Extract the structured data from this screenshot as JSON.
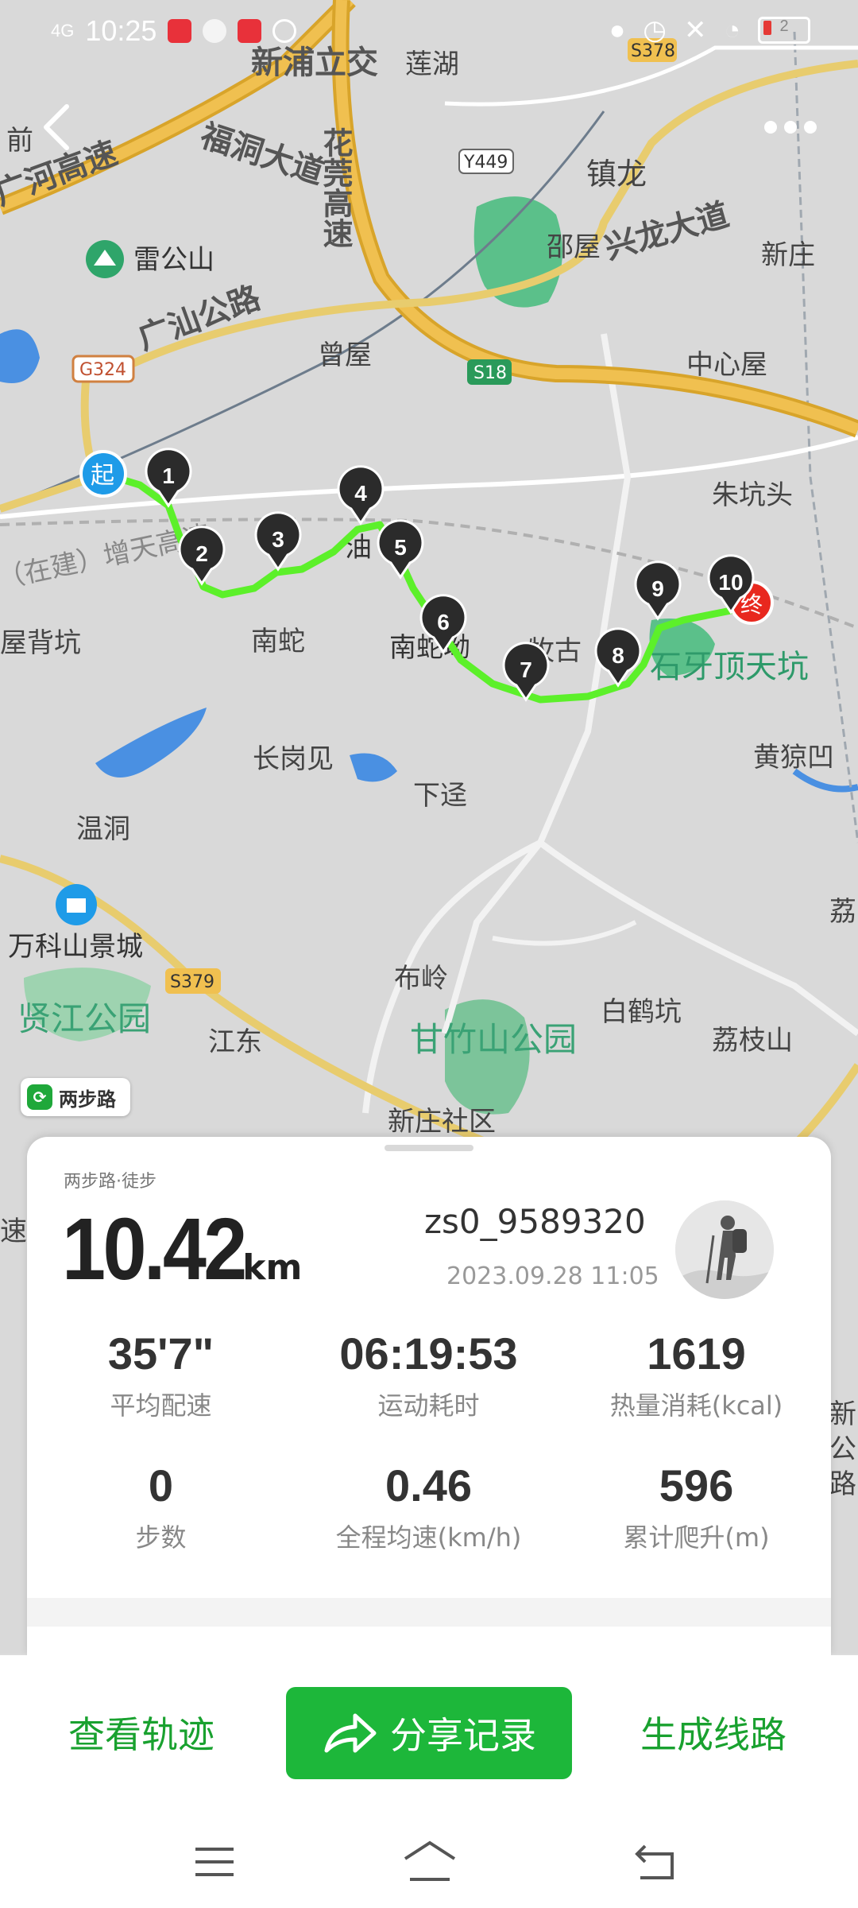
{
  "status_bar": {
    "network": "4G",
    "time": "10:25",
    "battery": "2"
  },
  "map": {
    "roads": {
      "guanghe": "广河高速",
      "fudong": "福洞大道",
      "huaguan": "花莞高速",
      "guangshan": "广汕公路",
      "xinglong": "兴龙大道",
      "xinpu": "新浦立交"
    },
    "road_badges": {
      "g324": "G324",
      "s18": "S18",
      "y449": "Y449",
      "s378": "S378",
      "s379": "S379"
    },
    "places": {
      "qian": "前",
      "lianhu": "莲湖",
      "zhenlong": "镇龙",
      "shaowu": "邵屋",
      "xinzhuang": "新庄",
      "leigongshan": "雷公山",
      "zengwu": "曾屋",
      "zhongxinwu": "中心屋",
      "zhukengtou": "朱坑头",
      "wubeikeng": "屋背坑",
      "nanshe": "南蛇",
      "youwu": "油",
      "nanshekeng": "南蛇坳",
      "mugu": "牧古",
      "shiyading": "石牙顶天坑",
      "huangyuan": "黄猄凹",
      "changgangjian": "长岗见",
      "xiajing": "下迳",
      "wendong": "温洞",
      "vankeshan": "万科山景城",
      "buling": "布岭",
      "baihekeng": "白鹤坑",
      "lizhishan": "荔枝山",
      "xianjiang": "贤江公园",
      "jiangdong": "江东",
      "ganzhushan": "甘竹山公园",
      "xinzhuangshequ": "新庄社区",
      "li_edge": "荔",
      "xin_edge": "新",
      "gong_edge": "公",
      "lu_edge": "路",
      "su_edge": "速",
      "zaijian": "（在建）增天高速"
    },
    "markers": [
      "1",
      "2",
      "3",
      "4",
      "5",
      "6",
      "7",
      "8",
      "9",
      "10"
    ],
    "start_label": "起",
    "end_label": "终"
  },
  "brand_badge": "两步路",
  "summary": {
    "source": "两步路·徒步",
    "distance": "10.42",
    "distance_unit": "km",
    "username": "zs0_9589320",
    "datetime": "2023.09.28 11:05",
    "stats": [
      {
        "value": "35'7\"",
        "label": "平均配速"
      },
      {
        "value": "06:19:53",
        "label": "运动耗时"
      },
      {
        "value": "1619",
        "label": "热量消耗(kcal)"
      },
      {
        "value": "0",
        "label": "步数"
      },
      {
        "value": "0.46",
        "label": "全程均速(km/h)"
      },
      {
        "value": "596",
        "label": "累计爬升(m)"
      }
    ]
  },
  "actions": {
    "view_track": "查看轨迹",
    "share": "分享记录",
    "generate_route": "生成线路"
  },
  "colors": {
    "accent": "#1db73a",
    "track": "#5cf02a",
    "marker": "#2b2b2b",
    "start": "#1e9be8",
    "end": "#e8281e"
  }
}
